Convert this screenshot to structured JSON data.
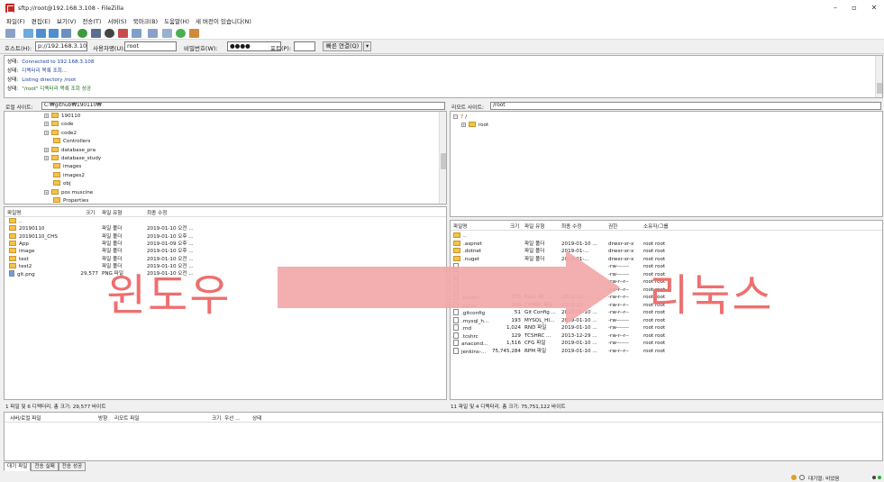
{
  "window": {
    "title": "sftp://root@192.168.3.108 - FileZilla",
    "minimize": "–",
    "maximize": "▫",
    "close": "✕"
  },
  "menu": [
    "파일(F)",
    "편집(E)",
    "보기(V)",
    "전송(T)",
    "서버(S)",
    "북마크(B)",
    "도움말(H)",
    "새 버전이 있습니다(N)"
  ],
  "quickconnect": {
    "host_label": "호스트(H):",
    "host_value": "p://192.168.3.108",
    "user_label": "사용자명(U):",
    "user_value": "root",
    "pass_label": "비밀번호(W):",
    "pass_value": "●●●●",
    "port_label": "포트(P):",
    "port_value": "",
    "connect_button": "빠른 연결(Q)",
    "dropdown": "▾"
  },
  "log": [
    {
      "label": "상태:",
      "text": "Connected to 192.168.3.108",
      "color": "blue"
    },
    {
      "label": "상태:",
      "text": "디렉터리 목록 조회...",
      "color": "blue"
    },
    {
      "label": "상태:",
      "text": "Listing directory /root",
      "color": "blue"
    },
    {
      "label": "상태:",
      "text": "\"/root\" 디렉터리 목록 조회 성공",
      "color": "green"
    }
  ],
  "local": {
    "site_label": "로컬 사이트:",
    "site_path": "C:₩github₩190110₩",
    "tree": [
      "190110",
      "code",
      "code2",
      "Controllers",
      "database_pra",
      "database_study",
      "images",
      "images2",
      "obj",
      "pos muscine",
      "Properties"
    ],
    "tree_expandable": [
      true,
      true,
      true,
      false,
      true,
      true,
      false,
      false,
      false,
      true,
      false
    ],
    "headers": [
      "파일명",
      "크기",
      "파일 유형",
      "최종 수정"
    ],
    "files": [
      {
        "name": "..",
        "size": "",
        "type": "",
        "modified": "",
        "icon": "folder"
      },
      {
        "name": "20190110",
        "size": "",
        "type": "파일 폴더",
        "modified": "2019-01-10 오전 ...",
        "icon": "folder"
      },
      {
        "name": "20190110_CHS",
        "size": "",
        "type": "파일 폴더",
        "modified": "2019-01-10 오후 ...",
        "icon": "folder"
      },
      {
        "name": "App",
        "size": "",
        "type": "파일 폴더",
        "modified": "2019-01-09 오후 ...",
        "icon": "folder"
      },
      {
        "name": "image",
        "size": "",
        "type": "파일 폴더",
        "modified": "2019-01-10 오후 ...",
        "icon": "folder"
      },
      {
        "name": "test",
        "size": "",
        "type": "파일 폴더",
        "modified": "2019-01-10 오전 ...",
        "icon": "folder"
      },
      {
        "name": "test2",
        "size": "",
        "type": "파일 폴더",
        "modified": "2019-01-10 오전 ...",
        "icon": "folder"
      },
      {
        "name": "git.png",
        "size": "29,577",
        "type": "PNG 파일",
        "modified": "2019-01-10 오전 ...",
        "icon": "image"
      }
    ],
    "status": "1 파일 및 6 디렉터리. 총 크기: 29,577 바이트"
  },
  "remote": {
    "site_label": "리모트 사이트:",
    "site_path": "/root",
    "tree_root": "/",
    "tree_child": "root",
    "headers": [
      "파일명",
      "크기",
      "파일 유형",
      "최종 수정",
      "권한",
      "소유자/그룹"
    ],
    "files": [
      {
        "name": "..",
        "size": "",
        "type": "",
        "modified": "",
        "perm": "",
        "owner": "",
        "icon": "folder"
      },
      {
        "name": ".aspnet",
        "size": "",
        "type": "파일 폴더",
        "modified": "2019-01-10 ...",
        "perm": "drwxr-xr-x",
        "owner": "root root",
        "icon": "folder"
      },
      {
        "name": ".dotnet",
        "size": "",
        "type": "파일 폴더",
        "modified": "2019-01-...",
        "perm": "drwxr-xr-x",
        "owner": "root root",
        "icon": "folder"
      },
      {
        "name": ".nuget",
        "size": "",
        "type": "파일 폴더",
        "modified": "2019-01-...",
        "perm": "drwxr-xr-x",
        "owner": "root root",
        "icon": "folder"
      },
      {
        "name": "",
        "size": "",
        "type": "",
        "modified": "",
        "perm": "-rw-------",
        "owner": "root root",
        "icon": "file"
      },
      {
        "name": "",
        "size": "",
        "type": "",
        "modified": "",
        "perm": "-rw-------",
        "owner": "root root",
        "icon": "file"
      },
      {
        "name": "",
        "size": "",
        "type": "",
        "modified": "",
        "perm": "-rw-r--r--",
        "owner": "root root",
        "icon": "file"
      },
      {
        "name": "",
        "size": "",
        "type": "",
        "modified": "",
        "perm": "-rw-r--r--",
        "owner": "root root",
        "icon": "file"
      },
      {
        "name": ".bashrc",
        "size": "176",
        "type": "Bash RC ...",
        "modified": "2013-12-...",
        "perm": "-rw-r--r--",
        "owner": "root root",
        "icon": "file"
      },
      {
        "name": ".cshrc",
        "size": "100",
        "type": "CSHRC 파일",
        "modified": "2013-12-...",
        "perm": "-rw-r--r--",
        "owner": "root root",
        "icon": "file"
      },
      {
        "name": ".gitconfig",
        "size": "51",
        "type": "Git Config ...",
        "modified": "2019-01-10 ...",
        "perm": "-rw-r--r--",
        "owner": "root root",
        "icon": "file"
      },
      {
        "name": ".mysql_h...",
        "size": "193",
        "type": "MYSQL_HI...",
        "modified": "2019-01-10 ...",
        "perm": "-rw-------",
        "owner": "root root",
        "icon": "file"
      },
      {
        "name": ".rnd",
        "size": "1,024",
        "type": "RND 파일",
        "modified": "2019-01-10 ...",
        "perm": "-rw-------",
        "owner": "root root",
        "icon": "file"
      },
      {
        "name": ".tcshrc",
        "size": "129",
        "type": "TCSHRC ...",
        "modified": "2013-12-29 ...",
        "perm": "-rw-r--r--",
        "owner": "root root",
        "icon": "file"
      },
      {
        "name": "anacond...",
        "size": "1,516",
        "type": "CFG 파일",
        "modified": "2019-01-10 ...",
        "perm": "-rw-------",
        "owner": "root root",
        "icon": "file"
      },
      {
        "name": "jenkins-...",
        "size": "75,745,284",
        "type": "RPM 파일",
        "modified": "2019-01-10 ...",
        "perm": "-rw-r--r--",
        "owner": "root root",
        "icon": "file"
      }
    ],
    "status": "11 파일 및 4 디렉터리. 총 크기: 75,751,122 바이트"
  },
  "queue": {
    "headers": [
      "서버/로컬 파일",
      "방향",
      "리모트 파일",
      "크기",
      "우선 ...",
      "상태"
    ]
  },
  "tabs": [
    "대기 파일",
    "전송 실패",
    "전송 성공"
  ],
  "bottom": {
    "queue_status": "대기열: 비었음"
  },
  "overlay": {
    "left_text": "윈도우",
    "right_text": "리눅스",
    "arrow_color": "#f2a8a8",
    "text_color": "#ee6f6f"
  }
}
